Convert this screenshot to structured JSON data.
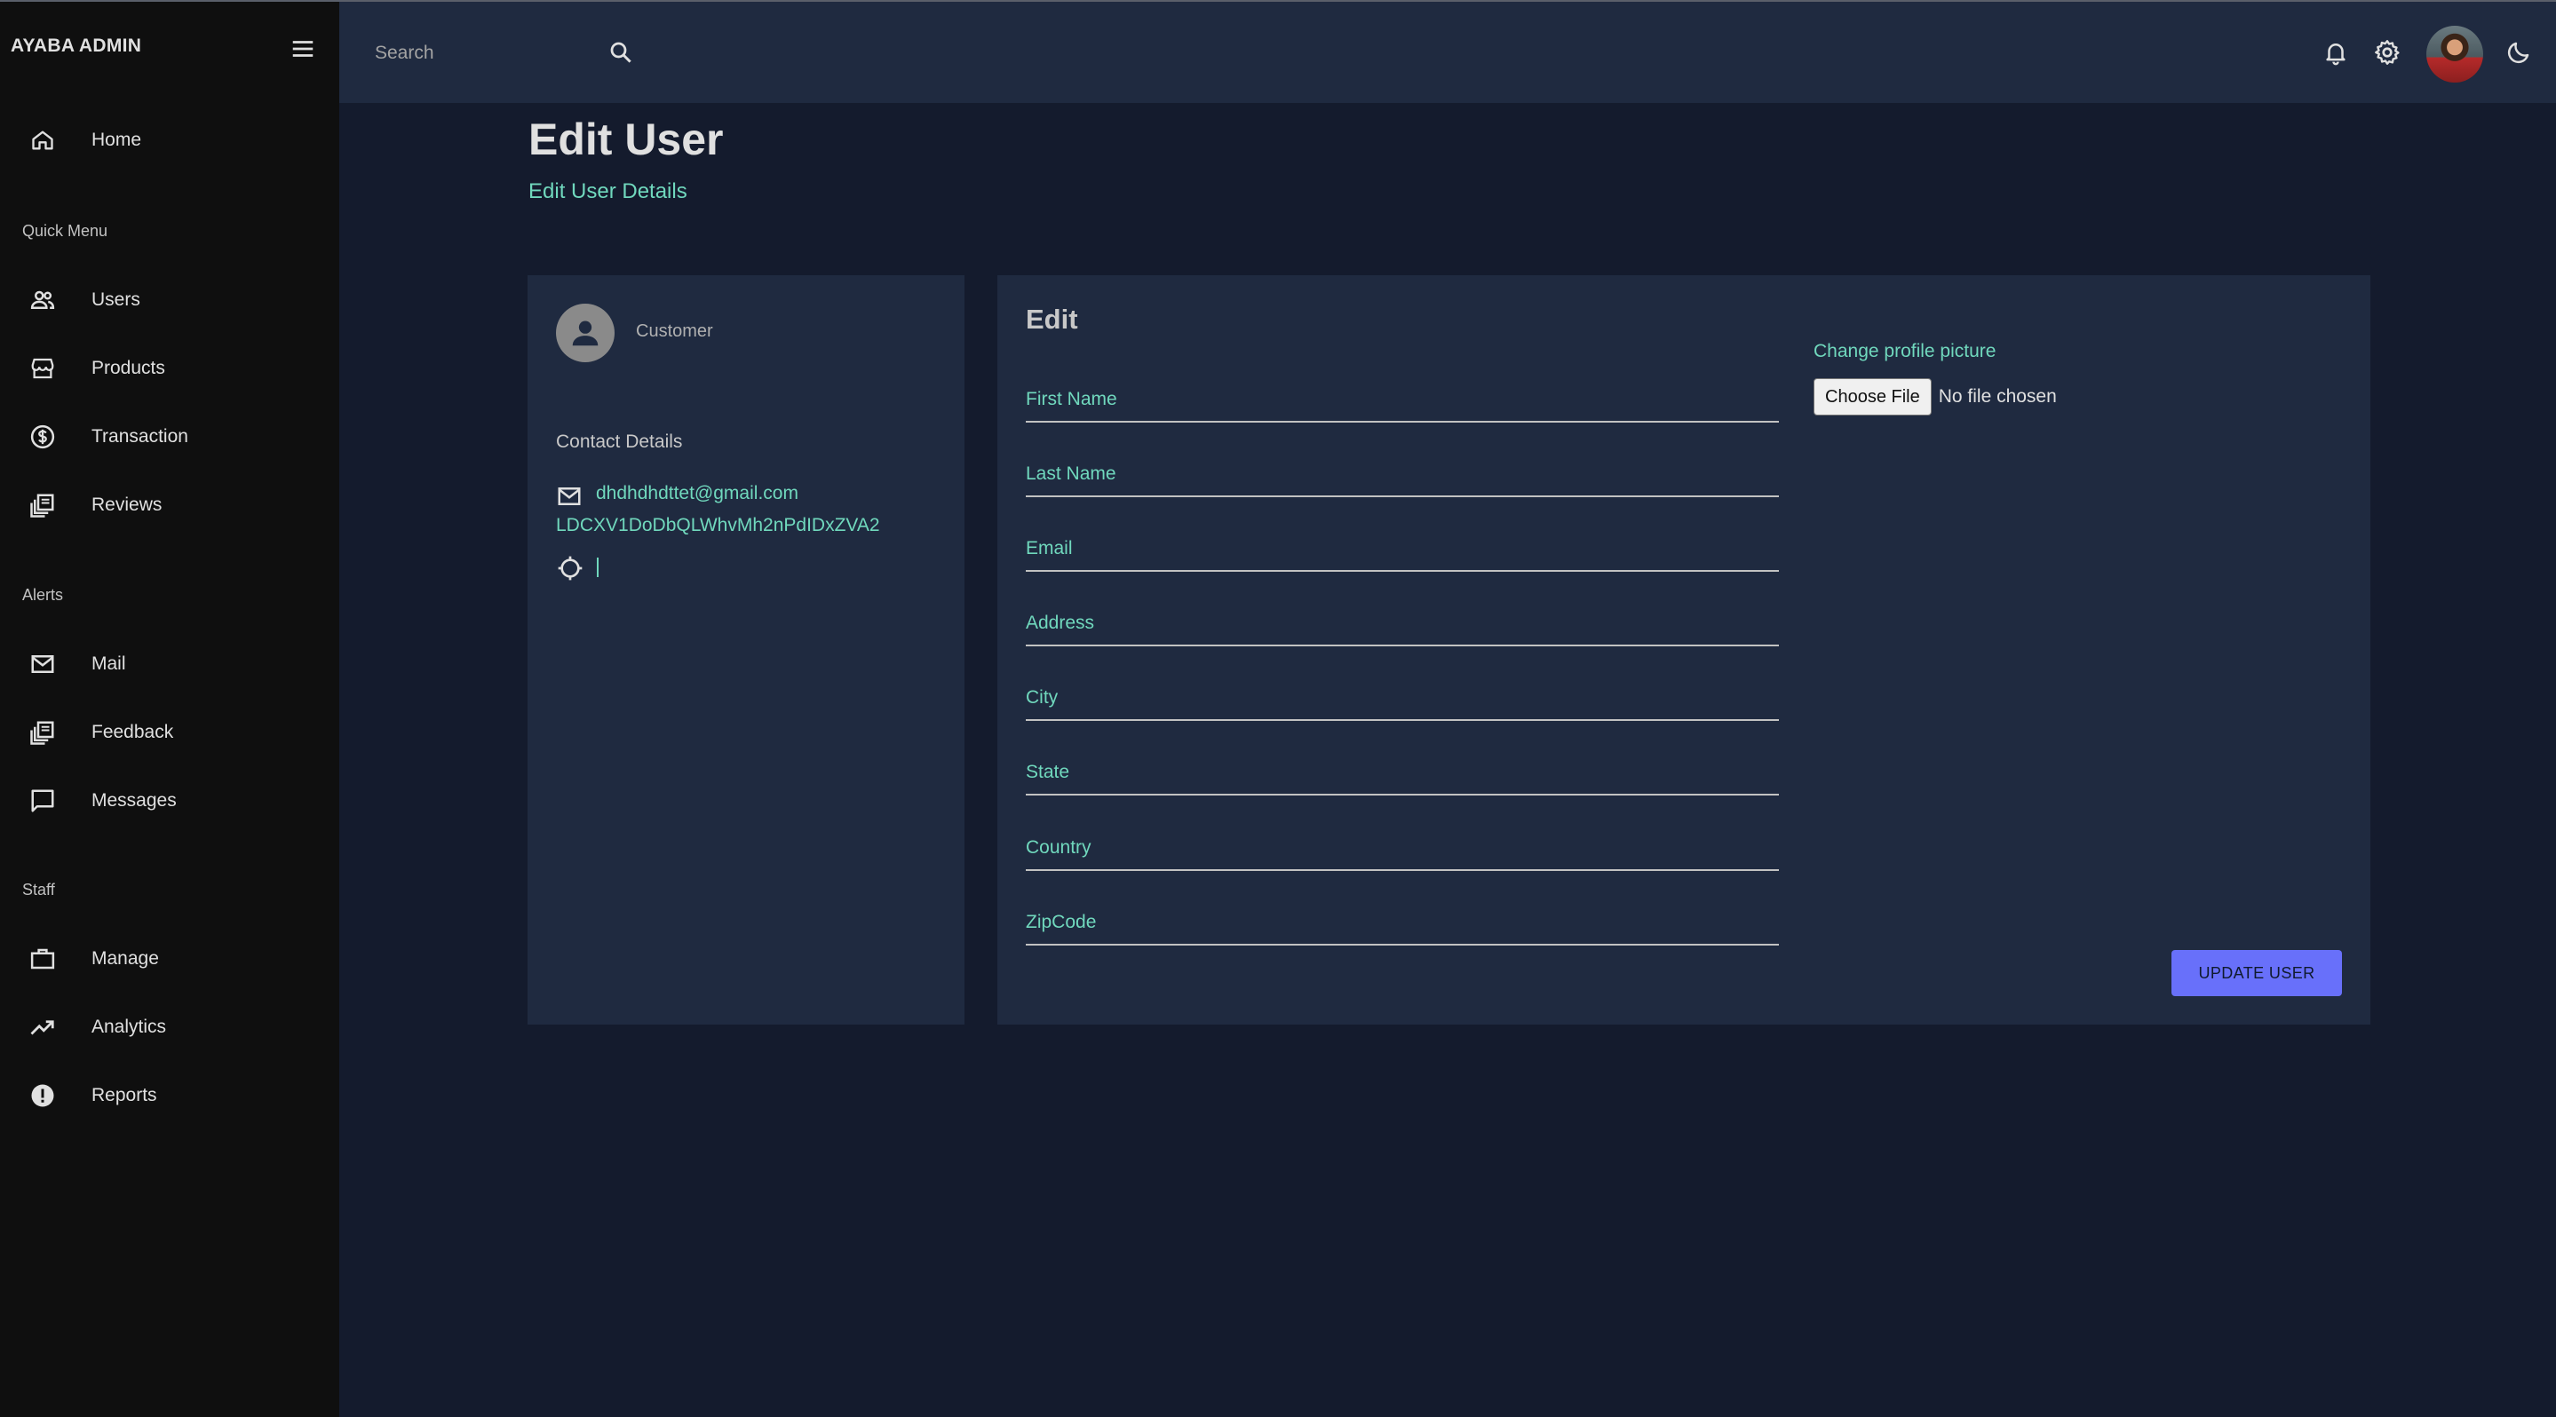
{
  "app": {
    "brand": "AYABA ADMIN"
  },
  "topbar": {
    "search_placeholder": "Search",
    "icons": [
      "search-icon",
      "bell-icon",
      "gear-icon",
      "avatar",
      "moon-icon"
    ]
  },
  "sidebar": {
    "home": {
      "label": "Home",
      "icon": "home-icon"
    },
    "sections": [
      {
        "title": "Quick Menu",
        "items": [
          {
            "label": "Users",
            "icon": "users-icon"
          },
          {
            "label": "Products",
            "icon": "store-icon"
          },
          {
            "label": "Transaction",
            "icon": "dollar-icon"
          },
          {
            "label": "Reviews",
            "icon": "library-icon"
          }
        ]
      },
      {
        "title": "Alerts",
        "items": [
          {
            "label": "Mail",
            "icon": "mail-icon"
          },
          {
            "label": "Feedback",
            "icon": "library-icon"
          },
          {
            "label": "Messages",
            "icon": "chat-icon"
          }
        ]
      },
      {
        "title": "Staff",
        "items": [
          {
            "label": "Manage",
            "icon": "briefcase-icon"
          },
          {
            "label": "Analytics",
            "icon": "trending-up-icon"
          },
          {
            "label": "Reports",
            "icon": "alert-icon"
          }
        ]
      }
    ]
  },
  "header": {
    "title": "Edit User",
    "subtitle": "Edit User Details"
  },
  "user_card": {
    "role": "Customer",
    "contact_title": "Contact Details",
    "email": "dhdhdhdttet@gmail.com",
    "id": "LDCXV1DoDbQLWhvMh2nPdIDxZVA2"
  },
  "edit_form": {
    "title": "Edit",
    "fields": [
      {
        "placeholder": "First Name"
      },
      {
        "placeholder": "Last Name"
      },
      {
        "placeholder": "Email"
      },
      {
        "placeholder": "Address"
      },
      {
        "placeholder": "City"
      },
      {
        "placeholder": "State"
      },
      {
        "placeholder": "Country"
      },
      {
        "placeholder": "ZipCode"
      }
    ],
    "change_picture_label": "Change profile picture",
    "choose_file_label": "Choose File",
    "file_status": "No file chosen",
    "submit_label": "UPDATE USER"
  },
  "colors": {
    "background": "#141b2d",
    "panel": "#1f2a40",
    "sidebar": "#0f0f0f",
    "accent_green": "#70d8bd",
    "accent_blue": "#6870fa"
  }
}
